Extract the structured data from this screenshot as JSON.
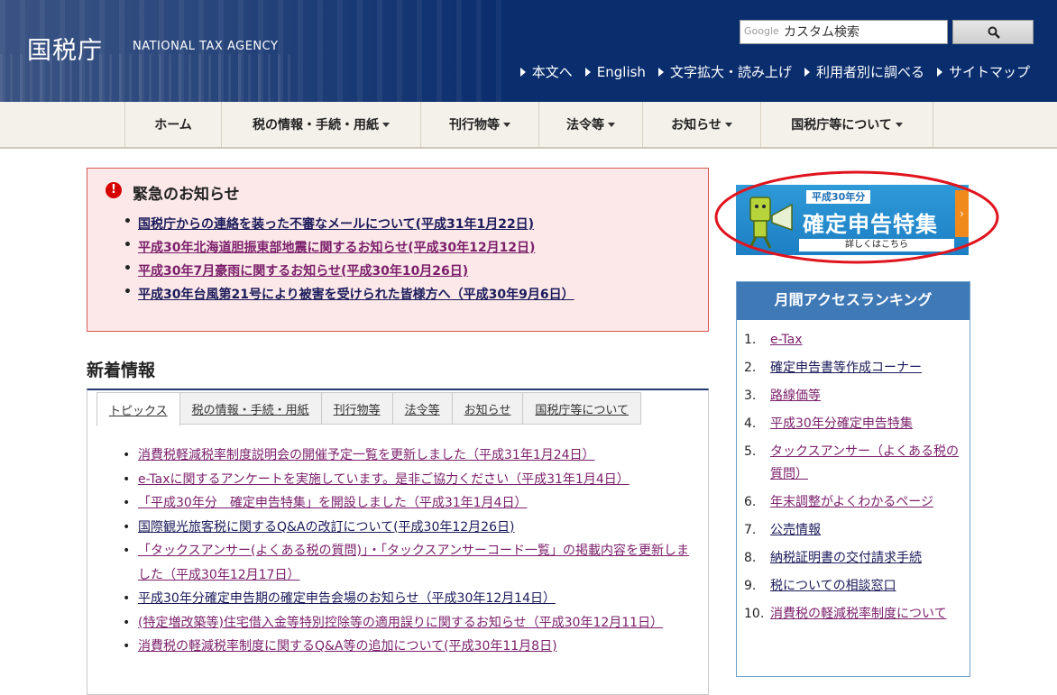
{
  "header": {
    "logo_jp": "国税庁",
    "logo_en": "NATIONAL TAX AGENCY",
    "search": {
      "brand": "Google",
      "placeholder": "カスタム検索"
    },
    "util_links": [
      "本文へ",
      "English",
      "文字拡大・読み上げ",
      "利用者別に調べる",
      "サイトマップ"
    ]
  },
  "nav": {
    "items": [
      {
        "label": "ホーム",
        "dropdown": false
      },
      {
        "label": "税の情報・手続・用紙",
        "dropdown": true
      },
      {
        "label": "刊行物等",
        "dropdown": true
      },
      {
        "label": "法令等",
        "dropdown": true
      },
      {
        "label": "お知らせ",
        "dropdown": true
      },
      {
        "label": "国税庁等について",
        "dropdown": true
      }
    ]
  },
  "emergency": {
    "title": "緊急のお知らせ",
    "items": [
      "国税庁からの連絡を装った不審なメールについて(平成31年1月22日)",
      "平成30年北海道胆振東部地震に関するお知らせ(平成30年12月12日)",
      "平成30年7月豪雨に関するお知らせ(平成30年10月26日)",
      "平成30年台風第21号により被害を受けられた皆様方へ（平成30年9月6日）"
    ]
  },
  "news": {
    "heading": "新着情報",
    "tabs": [
      "トピックス",
      "税の情報・手続・用紙",
      "刊行物等",
      "法令等",
      "お知らせ",
      "国税庁等について"
    ],
    "active_tab": "トピックス",
    "items": [
      "消費税軽減税率制度説明会の開催予定一覧を更新しました（平成31年1月24日）",
      "e-Taxに関するアンケートを実施しています。是非ご協力ください（平成31年1月4日）",
      "「平成30年分　確定申告特集」を開設しました（平成31年1月4日）",
      "国際観光旅客税に関するQ&Aの改訂について(平成30年12月26日)",
      "「タックスアンサー(よくある税の質問)」・「タックスアンサーコード一覧」の掲載内容を更新しました（平成30年12月17日）",
      "平成30年分確定申告期の確定申告会場のお知らせ（平成30年12月14日）",
      "(特定増改築等)住宅借入金等特別控除等の適用誤りに関するお知らせ（平成30年12月11日）",
      "消費税の軽減税率制度に関するQ&A等の追加について(平成30年11月8日)"
    ]
  },
  "banner": {
    "year_badge": "平成30年分",
    "title": "確定申告特集",
    "subtitle": "詳しくはこちら",
    "arrow": "›"
  },
  "ranking": {
    "title": "月間アクセスランキング",
    "items": [
      {
        "num": "1.",
        "label": "e-Tax"
      },
      {
        "num": "2.",
        "label": "確定申告書等作成コーナー"
      },
      {
        "num": "3.",
        "label": "路線価等"
      },
      {
        "num": "4.",
        "label": "平成30年分確定申告特集"
      },
      {
        "num": "5.",
        "label": "タックスアンサー（よくある税の質問）"
      },
      {
        "num": "6.",
        "label": "年末調整がよくわかるページ"
      },
      {
        "num": "7.",
        "label": "公売情報"
      },
      {
        "num": "8.",
        "label": "納税証明書の交付請求手続"
      },
      {
        "num": "9.",
        "label": "税についての相談窓口"
      },
      {
        "num": "10.",
        "label": "消費税の軽減税率制度について"
      }
    ]
  },
  "colors": {
    "header_bg": "#0a2d6e",
    "nav_bg": "#f4f1ea",
    "emergency_bg": "#fce8e8",
    "emergency_border": "#d95757",
    "link_visited": "#7b1f6b",
    "link": "#1a1a5a",
    "ranking_header": "#3f79b6",
    "banner_bg": "#1d7fc4",
    "annotation": "#e0141e"
  }
}
